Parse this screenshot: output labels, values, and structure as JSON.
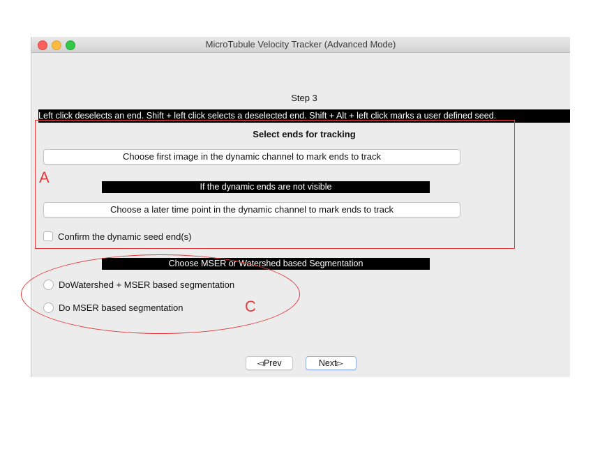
{
  "window": {
    "title": "MicroTubule Velocity Tracker (Advanced Mode)"
  },
  "content": {
    "step_label": "Step 3",
    "instruction": "Left click deselects an end. Shift + left click selects a deselected end. Shift + Alt + left click marks a user defined seed.",
    "select_title": "Select ends for tracking",
    "button_first_image": "Choose first image in the dynamic channel to mark ends to track",
    "not_visible_header": "If the dynamic ends are not visible",
    "button_later_time": "Choose a later time point in the dynamic channel to mark ends to track",
    "confirm_checkbox_label": "Confirm the dynamic seed end(s)",
    "confirm_checked": false,
    "segmentation_header": "Choose MSER or Watershed based Segmentation",
    "radio_watershed_label": "DoWatershed +  MSER based segmentation",
    "radio_mser_label": "Do MSER based segmentation",
    "radio_selected": null
  },
  "nav": {
    "prev_label": "◅Prev",
    "next_label": "Next▻"
  },
  "annotations": {
    "box_label": "A",
    "ellipse_label": "C",
    "color": "#e23c3c"
  },
  "colors": {
    "window_bg": "#ececec",
    "header_bar": "#000000",
    "close": "#fc605c",
    "minimize": "#fdbc40",
    "maximize": "#34c84a"
  }
}
